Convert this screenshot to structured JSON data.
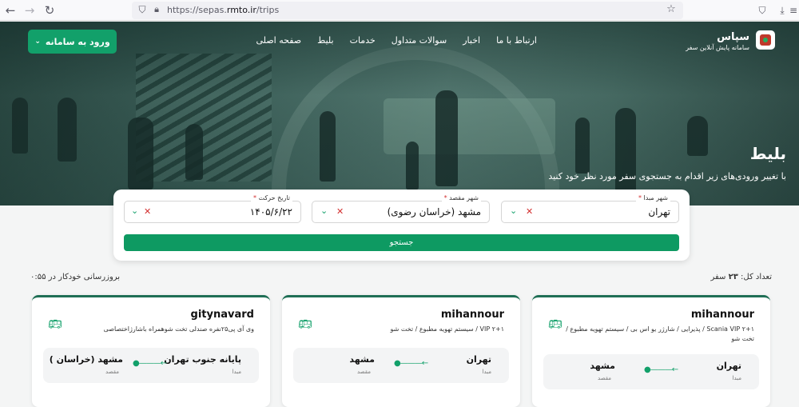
{
  "browser": {
    "url_prefix": "https://sepas.",
    "url_domain": "rmto.ir",
    "url_path": "/trips"
  },
  "header": {
    "brand_title": "سپاس",
    "brand_subtitle": "سامانه پایش آنلاین سفر",
    "nav": [
      "صفحه اصلی",
      "بلیط",
      "خدمات",
      "سوالات متداول",
      "اخبار",
      "ارتباط با ما"
    ],
    "login_label": "ورود به سامانه"
  },
  "hero": {
    "title": "بلیط",
    "subtitle": "با تغییر ورودی‌های زیر اقدام به جستجوی سفر مورد نظر خود کنید"
  },
  "search": {
    "origin_label": "شهر مبدا",
    "origin_value": "تهران",
    "destination_label": "شهر مقصد",
    "destination_value": "مشهد (خراسان رضوی)",
    "date_label": "تاریخ حرکت",
    "date_value": "۱۴۰۵/۶/۲۲",
    "required_mark": "*",
    "search_label": "جستجو"
  },
  "results": {
    "count_prefix": "تعداد کل:",
    "count_value": "۲۳",
    "count_suffix": "سفر",
    "refresh_text": "بروزرسانی خودکار در ۰:۵۵"
  },
  "trips": [
    {
      "company": "mihannour",
      "description": "Scania VIP ۲+۱ / پذیرایی / شارژر یو اس بی / سیستم تهویه مطبوع / تخت شو",
      "origin": "تهران",
      "origin_label": "مبدا",
      "destination": "مشهد",
      "destination_label": "مقصد"
    },
    {
      "company": "mihannour",
      "description": "VIP ۲+۱ / سیستم تهویه مطبوع / تخت شو",
      "origin": "تهران",
      "origin_label": "مبدا",
      "destination": "مشهد",
      "destination_label": "مقصد"
    },
    {
      "company": "gitynavard",
      "description": "وی آی پی۲۵نفره صندلی تخت شوهمراه باشارژاختصاصی",
      "origin": "پایانه جنوب تهران",
      "origin_label": "مبدا",
      "destination": "مشهد (خراسان )",
      "destination_label": "مقصد"
    }
  ],
  "icons": {
    "back": "arrow-left-icon",
    "forward": "arrow-right-icon",
    "reload": "reload-icon",
    "shield": "shield-icon",
    "lock": "lock-icon",
    "star": "star-icon",
    "pocket": "pocket-icon",
    "download": "download-icon",
    "menu": "menu-icon",
    "bus": "bus-icon"
  },
  "colors": {
    "accent": "#12a06a",
    "required": "#d32f2f"
  }
}
